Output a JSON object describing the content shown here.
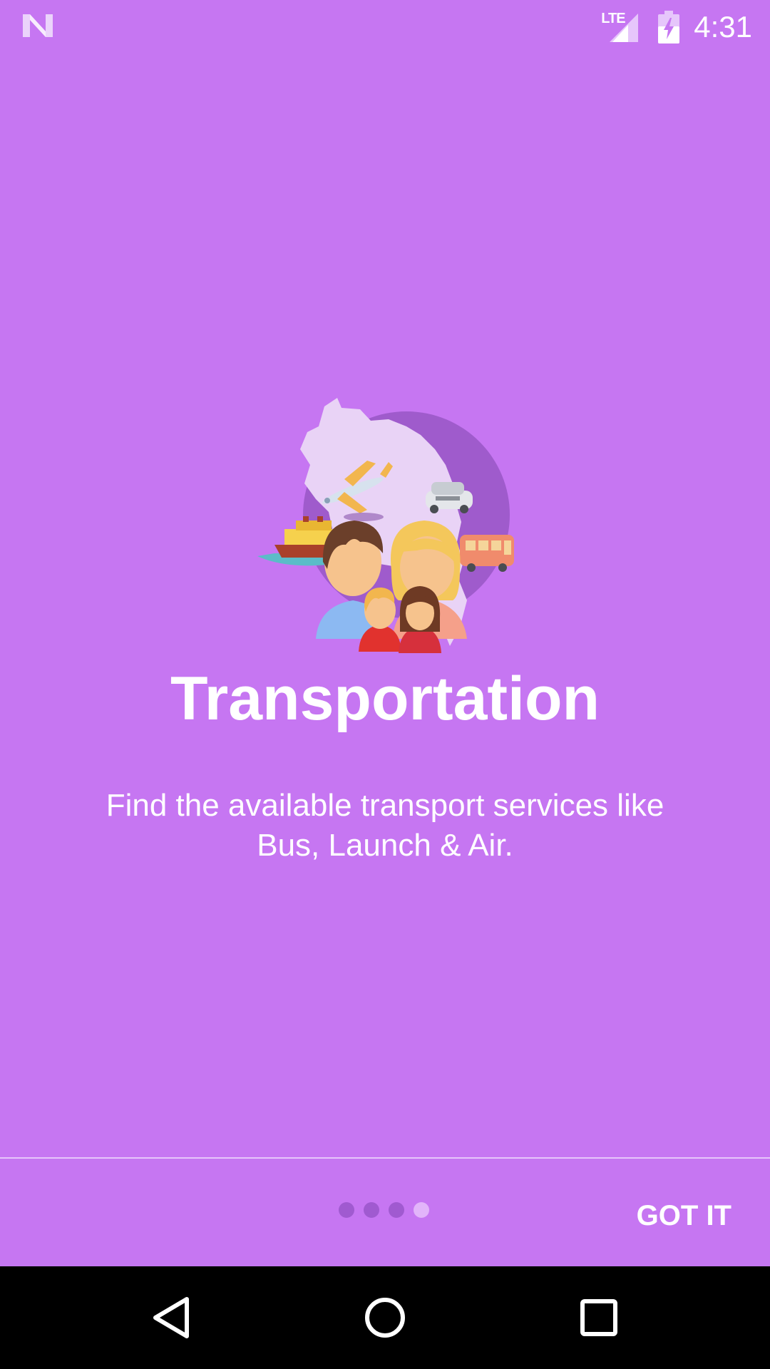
{
  "status_bar": {
    "time": "4:31",
    "network_label": "LTE",
    "icons": [
      "notification-n-icon",
      "lte-signal-icon",
      "battery-charging-icon"
    ]
  },
  "onboarding": {
    "illustration": "transportation-illustration",
    "title": "Transportation",
    "description": "Find the available transport services like Bus, Launch & Air."
  },
  "pager": {
    "total": 4,
    "active_index": 3
  },
  "actions": {
    "got_it_label": "GOT IT"
  },
  "nav_bar": {
    "icons": [
      "back-icon",
      "home-icon",
      "recents-icon"
    ]
  },
  "colors": {
    "background": "#c676f2",
    "dot_inactive": "#a05ad0",
    "dot_active": "#e2b4fa",
    "nav_bar": "#000000"
  }
}
